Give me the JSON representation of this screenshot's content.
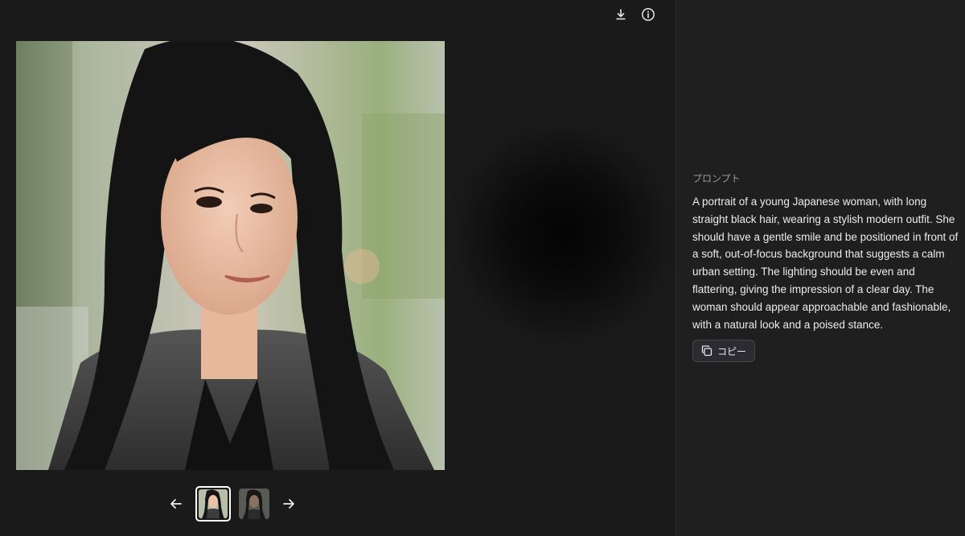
{
  "toolbar": {
    "download_icon": "download-icon",
    "info_icon": "info-icon"
  },
  "image": {
    "subject": "portrait-photo"
  },
  "gallery": {
    "prev_icon": "arrow-left-icon",
    "next_icon": "arrow-right-icon",
    "thumbnails": [
      {
        "selected": true
      },
      {
        "selected": false
      }
    ]
  },
  "sidebar": {
    "prompt_label": "プロンプト",
    "prompt_text": "A portrait of a young Japanese woman, with long straight black hair, wearing a stylish modern outfit. She should have a gentle smile and be positioned in front of a soft, out-of-focus background that suggests a calm urban setting. The lighting should be even and flattering, giving the impression of a clear day. The woman should appear approachable and fashionable, with a natural look and a poised stance.",
    "copy_label": "コピー",
    "copy_icon": "copy-icon"
  },
  "colors": {
    "viewer_bg": "#1a1a1a",
    "sidebar_bg": "#1f1f1f",
    "text": "#ececec",
    "muted": "#9a9a9a"
  }
}
